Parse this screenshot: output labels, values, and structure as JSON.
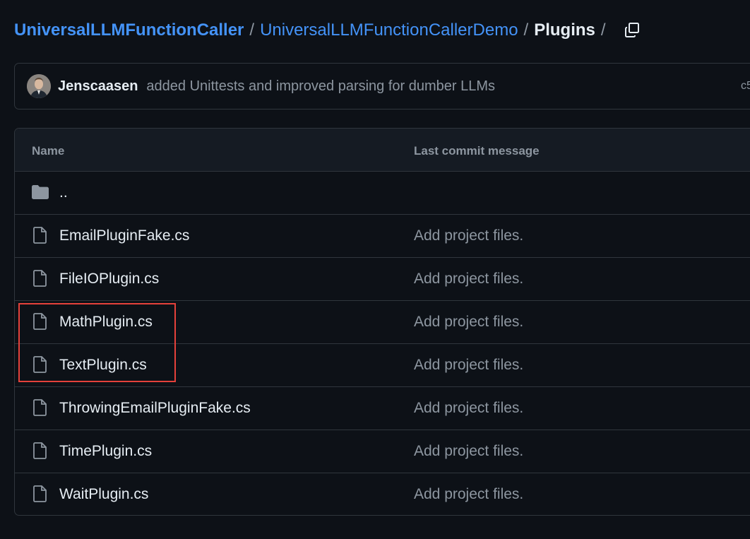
{
  "breadcrumb": {
    "repo": "UniversalLLMFunctionCaller",
    "folder": "UniversalLLMFunctionCallerDemo",
    "current": "Plugins",
    "separator": "/",
    "trailing_separator": "/"
  },
  "commit": {
    "author": "Jenscaasen",
    "message": "added Unittests and improved parsing for dumber LLMs",
    "sha_partial": "c5"
  },
  "table": {
    "headers": {
      "name": "Name",
      "last_commit": "Last commit message"
    },
    "parent_dir": "..",
    "rows": [
      {
        "name": "EmailPluginFake.cs",
        "commit": "Add project files."
      },
      {
        "name": "FileIOPlugin.cs",
        "commit": "Add project files."
      },
      {
        "name": "MathPlugin.cs",
        "commit": "Add project files."
      },
      {
        "name": "TextPlugin.cs",
        "commit": "Add project files."
      },
      {
        "name": "ThrowingEmailPluginFake.cs",
        "commit": "Add project files."
      },
      {
        "name": "TimePlugin.cs",
        "commit": "Add project files."
      },
      {
        "name": "WaitPlugin.cs",
        "commit": "Add project files."
      }
    ]
  },
  "icons": {
    "copy": "copy-icon",
    "folder": "folder-icon",
    "file": "file-icon"
  },
  "colors": {
    "background": "#0d1117",
    "link": "#4493f8",
    "muted": "#8d96a0",
    "border": "#30363d",
    "highlight": "#e5413b"
  }
}
